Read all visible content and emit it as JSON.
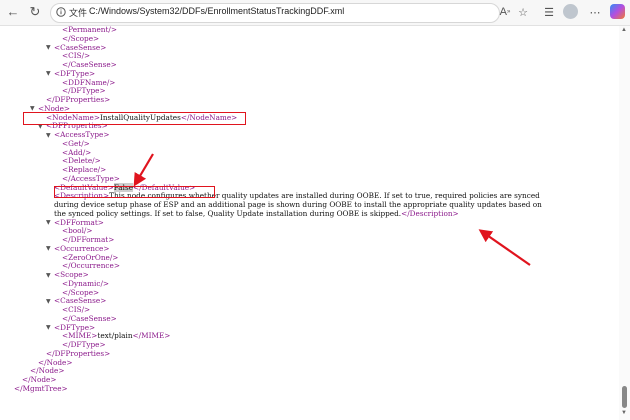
{
  "browser": {
    "file_label": "文件",
    "url": "C:/Windows/System32/DDFs/EnrollmentStatusTrackingDDF.xml"
  },
  "xml": [
    "<Permanent/>",
    "</Scope>",
    "<CaseSense>",
    "<CIS/>",
    "</CaseSense>",
    "<DFType>",
    "<DDFName/>",
    "</DFType>",
    "</DFProperties>",
    "<Node>",
    "<NodeName>InstallQualityUpdates</NodeName>",
    "<DFProperties>",
    "<AccessType>",
    "<Get/>",
    "<Add/>",
    "<Delete/>",
    "<Replace/>",
    "</AccessType>",
    "<DefaultValue>False</DefaultValue>",
    "<Description>This node configures whether quality updates are installed during OOBE. If set to true, required policies are synced",
    "during device setup phase of ESP and an additional page is shown during OOBE to install the appropriate quality updates based on",
    "the synced policy settings. If set to false, Quality Update installation during OOBE is skipped.</Description>",
    "<DFFormat>",
    "<bool/>",
    "</DFFormat>",
    "<Occurrence>",
    "<ZeroOrOne/>",
    "</Occurrence>",
    "<Scope>",
    "<Dynamic/>",
    "</Scope>",
    "<CaseSense>",
    "<CIS/>",
    "</CaseSense>",
    "<DFType>",
    "<MIME>text/plain</MIME>",
    "</DFType>",
    "</DFProperties>",
    "</Node>",
    "</Node>",
    "</Node>",
    "</MgmtTree>"
  ]
}
